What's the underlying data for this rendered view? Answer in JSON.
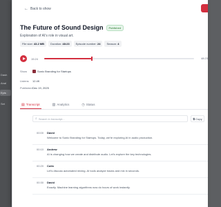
{
  "backdrop": {
    "items": [
      {
        "label": "Dash"
      },
      {
        "label": "Anal"
      },
      {
        "label": "Pod"
      },
      {
        "label": "Epis",
        "active": true
      },
      {
        "label": "Set"
      }
    ]
  },
  "header": {
    "back_label": "Back to show"
  },
  "episode": {
    "title": "The Future of Sound Design",
    "status": "Published",
    "description": "Exploration of AI's role in visual art.",
    "meta": [
      {
        "label": "File size:",
        "value": "43.2 MB"
      },
      {
        "label": "Duration:",
        "value": "48:23"
      },
      {
        "label": "Episode number:",
        "value": "24"
      },
      {
        "label": "Season:",
        "value": "4"
      }
    ]
  },
  "player": {
    "current_time": "15:24",
    "end_time": "48:23",
    "progress": 0.32
  },
  "details": {
    "show_label": "Show",
    "show_value": "Sonic Branding for Startups",
    "listens_label": "Listens",
    "listens_value": "12.4K",
    "published_label": "Published",
    "published_value": "Dec 19, 2025"
  },
  "tabs": [
    {
      "label": "Transcript",
      "icon": "doc-icon",
      "active": true
    },
    {
      "label": "Analytics",
      "icon": "chart-icon",
      "active": false
    },
    {
      "label": "Status",
      "icon": "clock-icon",
      "active": false
    }
  ],
  "transcript_tools": {
    "search_placeholder": "Search in transcript...",
    "copy_label": "Copy"
  },
  "segments": [
    {
      "time": "00:00",
      "speaker": "David",
      "text": "Welcome to Sonic Branding for Startups. Today, we're exploring AI in audio production."
    },
    {
      "time": "00:10",
      "speaker": "Andrew",
      "text": "AI is changing how we create and distribute audio. Let's explore the key technologies."
    },
    {
      "time": "00:20",
      "speaker": "Colin",
      "text": "Let's discuss automated mixing. AI tools analyze tracks and mix in seconds."
    },
    {
      "time": "00:30",
      "speaker": "David",
      "text": "Exactly. Machine learning algorithms now do hours of work instantly."
    }
  ],
  "colors": {
    "accent": "#d32f3f",
    "badge_green": "#2e7d32"
  }
}
